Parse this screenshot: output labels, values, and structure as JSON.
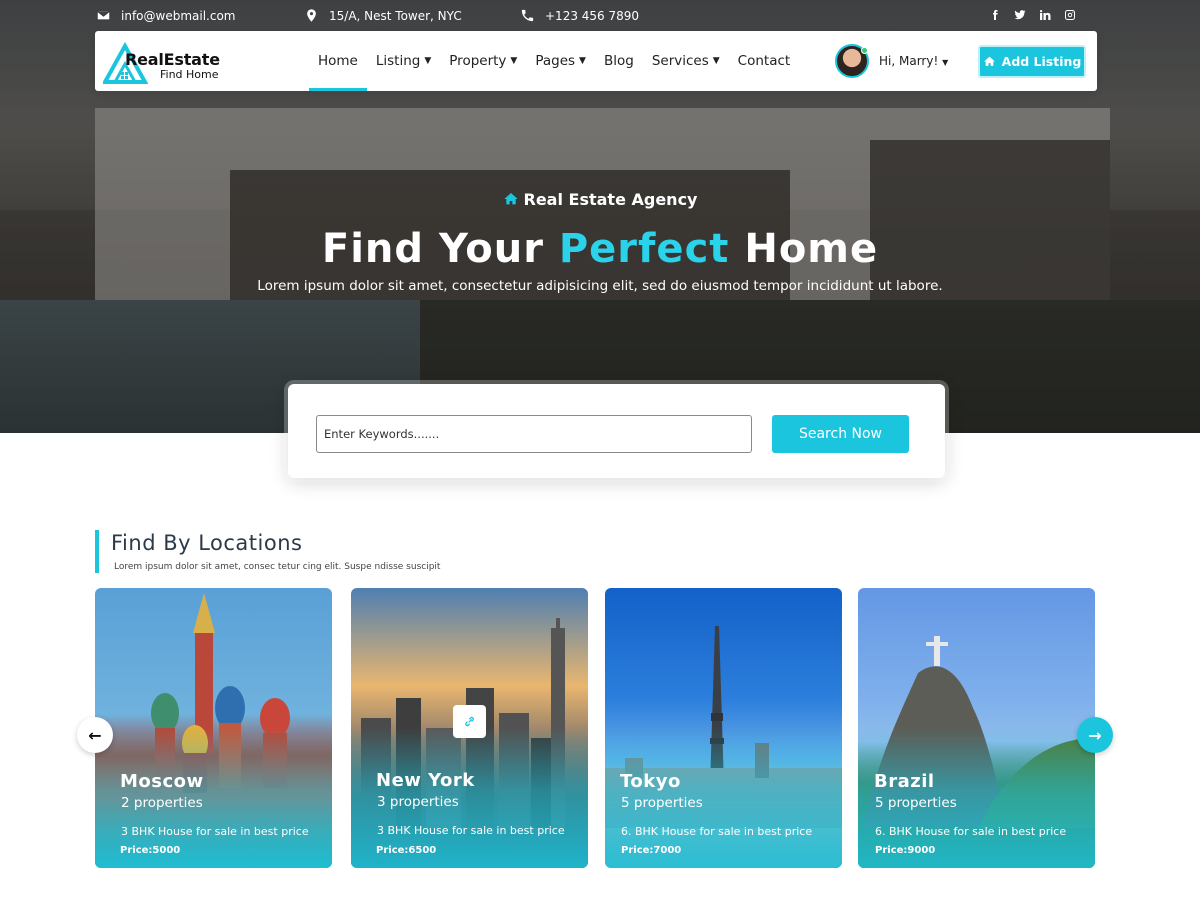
{
  "topbar": {
    "email": "info@webmail.com",
    "address": "15/A, Nest Tower, NYC",
    "phone": "+123 456 7890",
    "social_icons": [
      "facebook-icon",
      "twitter-icon",
      "linkedin-icon",
      "instagram-icon"
    ]
  },
  "logo": {
    "main": "RealEstate",
    "sub": "Find Home"
  },
  "nav": {
    "items": [
      {
        "label": "Home",
        "active": true,
        "dropdown": false
      },
      {
        "label": "Listing",
        "dropdown": true
      },
      {
        "label": "Property",
        "dropdown": true
      },
      {
        "label": "Pages",
        "dropdown": true
      },
      {
        "label": "Blog",
        "dropdown": false
      },
      {
        "label": "Services",
        "dropdown": true
      },
      {
        "label": "Contact",
        "dropdown": false
      }
    ],
    "user_greeting": "Hi, Marry!",
    "add_listing": "Add Listing"
  },
  "hero": {
    "tag": "Real Estate Agency",
    "title_start": "Find Your",
    "title_accent": "Perfect",
    "title_end": "Home",
    "subtitle": "Lorem ipsum dolor sit amet, consectetur adipisicing elit, sed do eiusmod tempor incididunt ut labore."
  },
  "search": {
    "placeholder": "Enter Keywords.......",
    "value": "",
    "button": "Search Now"
  },
  "locations": {
    "title": "Find By Locations",
    "subtitle": "Lorem ipsum dolor sit amet, consec tetur cing elit. Suspe ndisse suscipit",
    "cards": [
      {
        "name": "Moscow",
        "count": "2 properties",
        "desc": "3 BHK House for sale in best price",
        "price": "Price:5000"
      },
      {
        "name": "New York",
        "count": "3 properties",
        "desc": "3 BHK House for sale in best price",
        "price": "Price:6500"
      },
      {
        "name": "Tokyo",
        "count": "5 properties",
        "desc": "6. BHK House for sale in best price",
        "price": "Price:7000"
      },
      {
        "name": "Brazil",
        "count": "5 properties",
        "desc": "6. BHK House for sale in best price",
        "price": "Price:9000"
      }
    ],
    "prev_arrow": "←",
    "next_arrow": "→"
  },
  "colors": {
    "accent": "#1bc5de",
    "heading": "#2b3a4a"
  }
}
